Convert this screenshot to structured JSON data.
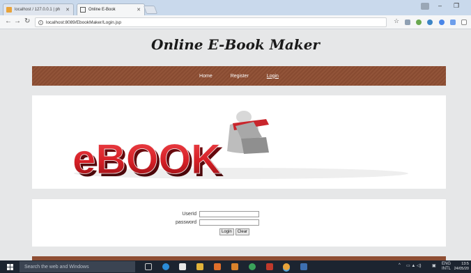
{
  "browser": {
    "tabs": [
      {
        "title": "localhost / 127.0.0.1 | ph"
      },
      {
        "title": "Online E-Book"
      }
    ],
    "url": "localhost:8089/EbookMaker/Login.jsp"
  },
  "page": {
    "heading": "Online E-Book Maker",
    "nav": [
      {
        "label": "Home"
      },
      {
        "label": "Register"
      },
      {
        "label": "Login"
      }
    ],
    "banner_text": "eBOOK",
    "form": {
      "userid_label": "UserId",
      "userid_value": "",
      "password_label": "password",
      "password_value": "",
      "login_button": "Login",
      "clear_button": "Clear"
    }
  },
  "taskbar": {
    "search_placeholder": "Search the web and Windows",
    "lang": "ENG",
    "layout": "INTL",
    "time": "13:5",
    "date": "24/05/20"
  },
  "colors": {
    "nav_bg": "#8e4e33",
    "page_bg": "#e6e7e8",
    "banner_red": "#d51f26"
  }
}
